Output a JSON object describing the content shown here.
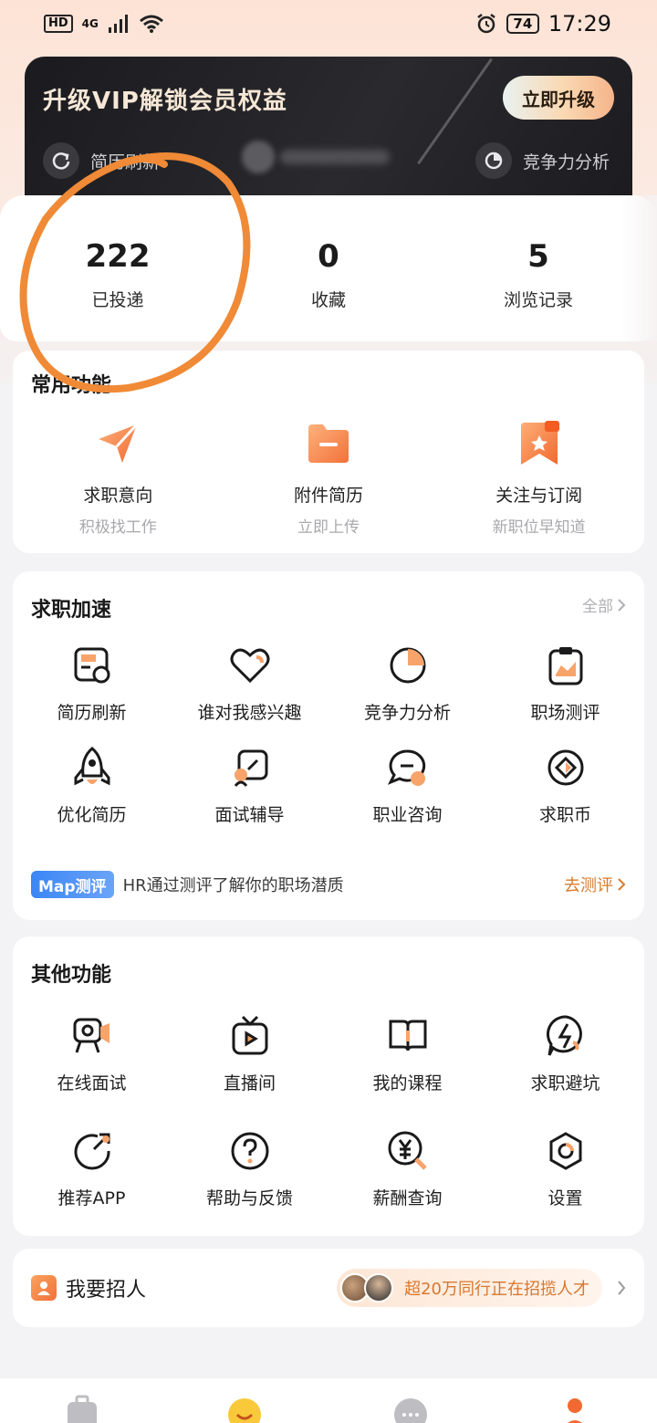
{
  "status_bar": {
    "hd": "HD",
    "network": "4G",
    "battery": "74",
    "time": "17:29"
  },
  "vip": {
    "title": "升级VIP解锁会员权益",
    "upgrade_button": "立即升级",
    "feature_left": "简历刷新",
    "feature_right": "竞争力分析"
  },
  "stats": [
    {
      "value": "222",
      "label": "已投递"
    },
    {
      "value": "0",
      "label": "收藏"
    },
    {
      "value": "5",
      "label": "浏览记录"
    }
  ],
  "common": {
    "title": "常用功能",
    "items": [
      {
        "label": "求职意向",
        "sub": "积极找工作",
        "icon": "paper-plane-icon"
      },
      {
        "label": "附件简历",
        "sub": "立即上传",
        "icon": "folder-icon"
      },
      {
        "label": "关注与订阅",
        "sub": "新职位早知道",
        "icon": "bookmark-icon"
      }
    ]
  },
  "boost": {
    "title": "求职加速",
    "all_link": "全部",
    "items": [
      {
        "label": "简历刷新",
        "icon": "resume-refresh-icon"
      },
      {
        "label": "谁对我感兴趣",
        "icon": "heart-icon"
      },
      {
        "label": "竞争力分析",
        "icon": "pie-chart-icon"
      },
      {
        "label": "职场测评",
        "icon": "clipboard-icon"
      },
      {
        "label": "优化简历",
        "icon": "rocket-icon"
      },
      {
        "label": "面试辅导",
        "icon": "interview-guide-icon"
      },
      {
        "label": "职业咨询",
        "icon": "chat-bubble-icon"
      },
      {
        "label": "求职币",
        "icon": "coin-icon"
      }
    ],
    "map_badge": "Map测评",
    "map_text": "HR通过测评了解你的职场潜质",
    "map_link": "去测评"
  },
  "other": {
    "title": "其他功能",
    "items": [
      {
        "label": "在线面试",
        "icon": "video-camera-icon"
      },
      {
        "label": "直播间",
        "icon": "tv-play-icon"
      },
      {
        "label": "我的课程",
        "icon": "book-icon"
      },
      {
        "label": "求职避坑",
        "icon": "lightning-shield-icon"
      },
      {
        "label": "推荐APP",
        "icon": "share-arrow-icon"
      },
      {
        "label": "帮助与反馈",
        "icon": "help-icon"
      },
      {
        "label": "薪酬查询",
        "icon": "yuan-search-icon"
      },
      {
        "label": "设置",
        "icon": "settings-icon"
      }
    ]
  },
  "recruit": {
    "label": "我要招人",
    "promo": "超20万同行正在招揽人才"
  },
  "colors": {
    "accent_orange": "#f47a3c",
    "promo_orange": "#d8772d",
    "map_blue": "#3b86f5",
    "vip_dark": "#1b1b1f",
    "annotation": "#f08a36"
  }
}
